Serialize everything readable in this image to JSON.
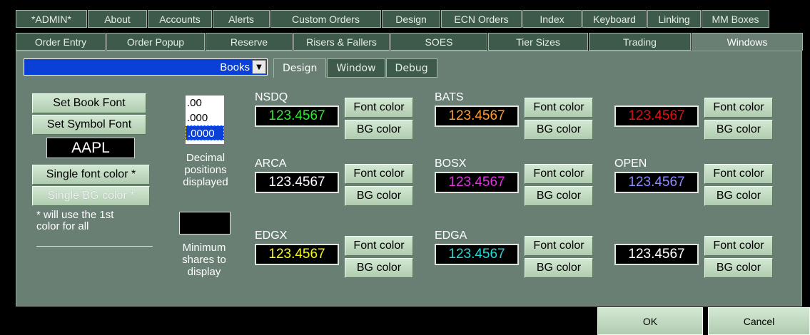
{
  "tabs_row1": [
    "*ADMIN*",
    "About",
    "Accounts",
    "Alerts",
    "Custom Orders",
    "Design",
    "ECN Orders",
    "Index",
    "Keyboard",
    "Linking",
    "MM Boxes"
  ],
  "tabs_row2": [
    "Order Entry",
    "Order Popup",
    "Reserve",
    "Risers & Fallers",
    "SOES",
    "Tier Sizes",
    "Trading",
    "Windows"
  ],
  "active_tab": "Windows",
  "book_select": {
    "value": "Books"
  },
  "subtabs": [
    "Design",
    "Window",
    "Debug"
  ],
  "left": {
    "set_book_font": "Set Book Font",
    "set_symbol_font": "Set Symbol Font",
    "symbol": "AAPL",
    "single_font_color": "Single font color *",
    "single_bg_color": "Single BG color *",
    "note_line1": "* will use the  1st",
    "note_line2": "color for  all"
  },
  "decimal": {
    "options": [
      ".00",
      ".000",
      ".0000"
    ],
    "selected": ".0000",
    "label_line1": "Decimal",
    "label_line2": "positions",
    "label_line3": "displayed"
  },
  "min_shares": {
    "label_line1": "Minimum",
    "label_line2": "shares to",
    "label_line3": "display"
  },
  "font_color_label": "Font color",
  "bg_color_label": "BG color",
  "exchanges": [
    {
      "name": "NSDQ",
      "price": "123.4567",
      "color": "#2ee82e"
    },
    {
      "name": "BATS",
      "price": "123.4567",
      "color": "#ff9a2e"
    },
    {
      "name": "",
      "price": "123.4567",
      "color": "#e01010"
    },
    {
      "name": "ARCA",
      "price": "123.4567",
      "color": "#ffffff"
    },
    {
      "name": "BOSX",
      "price": "123.4567",
      "color": "#e030e0"
    },
    {
      "name": "OPEN",
      "price": "123.4567",
      "color": "#8a8aff"
    },
    {
      "name": "EDGX",
      "price": "123.4567",
      "color": "#f5f51a"
    },
    {
      "name": "EDGA",
      "price": "123.4567",
      "color": "#20d8d8"
    },
    {
      "name": "",
      "price": "123.4567",
      "color": "#ffffff"
    }
  ],
  "buttons": {
    "ok": "OK",
    "cancel": "Cancel"
  }
}
